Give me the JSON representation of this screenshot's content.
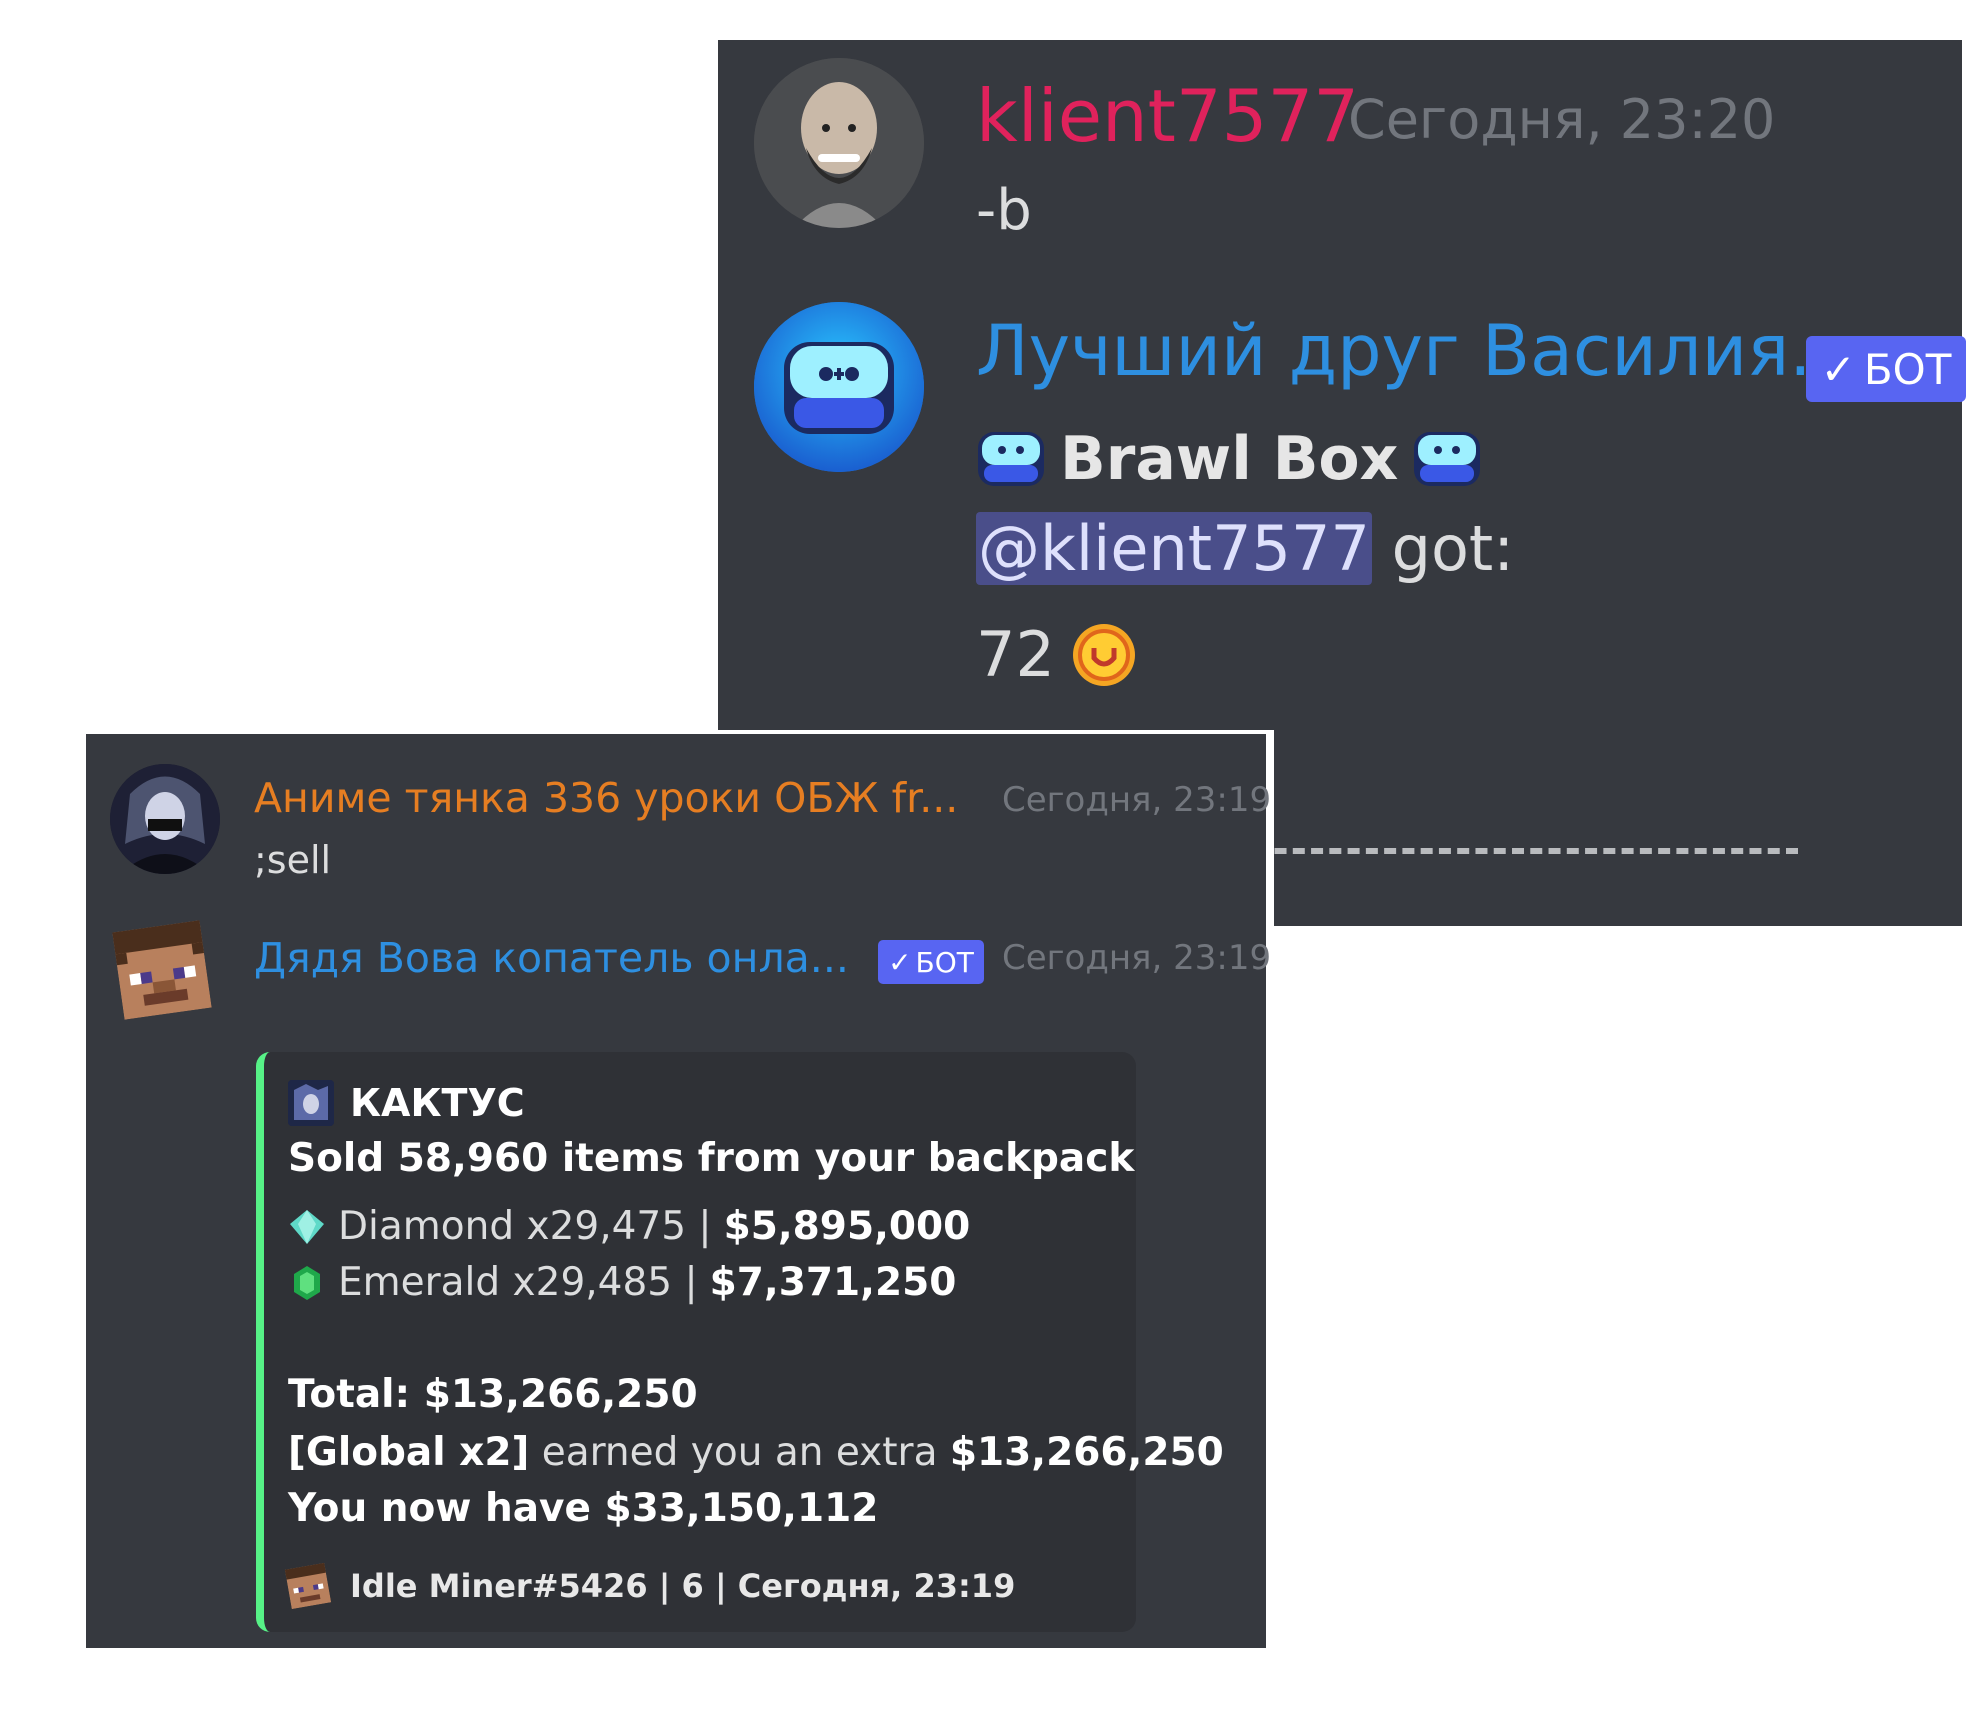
{
  "top_chat": {
    "message1": {
      "author": "klient7577",
      "timestamp": "Сегодня, 23:20",
      "content": "-b"
    },
    "message2": {
      "author": "Лучший друг Василия...",
      "bot_badge": "БОТ",
      "title": "Brawl Box",
      "mention": "@klient7577",
      "after_mention": " got:",
      "count": "72",
      "icon_names": [
        "brawl-box-icon",
        "coin-emoji-icon"
      ]
    }
  },
  "bottom_chat": {
    "message1": {
      "author": "Аниме тянка 336 уроки ОБЖ fr...",
      "timestamp": "Сегодня, 23:19",
      "content": ";sell"
    },
    "message2": {
      "author": "Дядя Вова копатель онла...",
      "bot_badge": "БОТ",
      "timestamp": "Сегодня, 23:19",
      "embed": {
        "author": "КАКТУС",
        "title": "Sold 58,960 items from your backpack",
        "items": [
          {
            "name": "Diamond x29,475 | ",
            "value": "$5,895,000",
            "icon": "diamond-icon"
          },
          {
            "name": "Emerald x29,485 | ",
            "value": "$7,371,250",
            "icon": "emerald-icon"
          }
        ],
        "total_label": "Total: ",
        "total_value": "$13,266,250",
        "bonus_tag": "[Global x2]",
        "bonus_text": " earned you an extra ",
        "bonus_value": "$13,266,250",
        "balance_label": "You now have ",
        "balance_value": "$33,150,112",
        "footer": "Idle Miner#5426 | 6 | Сегодня, 23:19"
      }
    }
  },
  "colors": {
    "background": "#36393f",
    "embed_bg": "#2f3136",
    "embed_accent": "#57f287",
    "bot_badge": "#5865f2",
    "name_red": "#e0225c",
    "name_blue": "#2e8fe0",
    "name_orange": "#e67e22"
  }
}
